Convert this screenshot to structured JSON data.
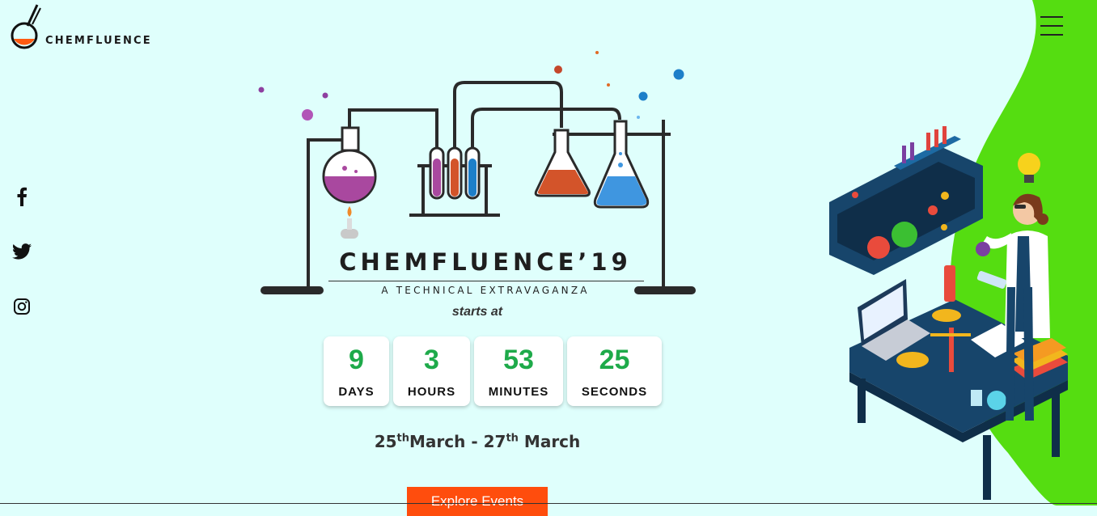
{
  "brand": {
    "name": "CHEMFLUENCE"
  },
  "nav": {
    "menu_icon": "hamburger-menu-icon"
  },
  "social": [
    {
      "name": "facebook",
      "icon": "facebook-icon"
    },
    {
      "name": "twitter",
      "icon": "twitter-icon"
    },
    {
      "name": "instagram",
      "icon": "instagram-icon"
    }
  ],
  "hero": {
    "title": "CHEMFLUENCE’19",
    "subtitle": "A TECHNICAL EXTRAVAGANZA",
    "starts_at": "starts at"
  },
  "countdown": {
    "days": {
      "value": "9",
      "label": "DAYS"
    },
    "hours": {
      "value": "3",
      "label": "HOURS"
    },
    "minutes": {
      "value": "53",
      "label": "MINUTES"
    },
    "seconds": {
      "value": "25",
      "label": "SECONDS"
    }
  },
  "dates": {
    "start_day": "25",
    "start_sup": "th",
    "start_month": "March",
    "separator": " - ",
    "end_day": "27",
    "end_sup": "th",
    "end_month": " March"
  },
  "cta": {
    "explore_label": "Explore Events"
  },
  "colors": {
    "background": "#dffffc",
    "accent_green": "#55dd11",
    "countdown_number": "#1eaa4a",
    "button": "#ff4d0d"
  }
}
